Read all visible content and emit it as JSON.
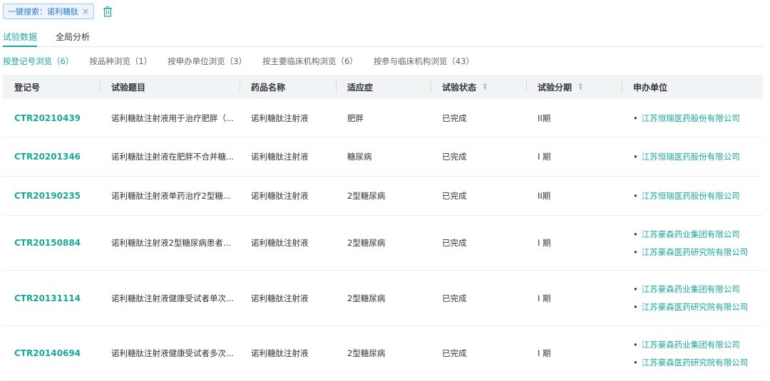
{
  "search": {
    "chip_label": "一键搜索：诺利糖肽",
    "close": "×"
  },
  "tabs": [
    {
      "label": "试验数据",
      "active": true
    },
    {
      "label": "全局分析",
      "active": false
    }
  ],
  "browse": [
    {
      "label": "按登记号浏览（6）",
      "active": true
    },
    {
      "label": "按品种浏览（1）",
      "active": false
    },
    {
      "label": "按申办单位浏览（3）",
      "active": false
    },
    {
      "label": "按主要临床机构浏览（6）",
      "active": false
    },
    {
      "label": "按参与临床机构浏览（43）",
      "active": false
    }
  ],
  "columns": [
    "登记号",
    "试验题目",
    "药品名称",
    "适应症",
    "试验状态",
    "试验分期",
    "申办单位"
  ],
  "rows": [
    {
      "reg": "CTR20210439",
      "title": "诺利糖肽注射液用于治疗肥胖（...",
      "drug": "诺利糖肽注射液",
      "indication": "肥胖",
      "status": "已完成",
      "phase": "II期",
      "sponsors": [
        "江苏恒瑞医药股份有限公司"
      ]
    },
    {
      "reg": "CTR20201346",
      "title": "诺利糖肽注射液在肥胖不合并糖...",
      "drug": "诺利糖肽注射液",
      "indication": "糖尿病",
      "status": "已完成",
      "phase": "I 期",
      "sponsors": [
        "江苏恒瑞医药股份有限公司"
      ]
    },
    {
      "reg": "CTR20190235",
      "title": "诺利糖肽注射液单药治疗2型糖...",
      "drug": "诺利糖肽注射液",
      "indication": "2型糖尿病",
      "status": "已完成",
      "phase": "II期",
      "sponsors": [
        "江苏恒瑞医药股份有限公司"
      ]
    },
    {
      "reg": "CTR20150884",
      "title": "诺利糖肽注射液2型糖尿病患者...",
      "drug": "诺利糖肽注射液",
      "indication": "2型糖尿病",
      "status": "已完成",
      "phase": "I 期",
      "sponsors": [
        "江苏豪森药业集团有限公司",
        "江苏豪森医药研究院有限公司"
      ]
    },
    {
      "reg": "CTR20131114",
      "title": "诺利糖肽注射液健康受试者单次...",
      "drug": "诺利糖肽注射液",
      "indication": "2型糖尿病",
      "status": "已完成",
      "phase": "I 期",
      "sponsors": [
        "江苏豪森药业集团有限公司",
        "江苏豪森医药研究院有限公司"
      ]
    },
    {
      "reg": "CTR20140694",
      "title": "诺利糖肽注射液健康受试者多次...",
      "drug": "诺利糖肽注射液",
      "indication": "2型糖尿病",
      "status": "已完成",
      "phase": "I 期",
      "sponsors": [
        "江苏豪森药业集团有限公司",
        "江苏豪森医药研究院有限公司"
      ]
    }
  ],
  "colors": {
    "accent": "#1aa89a",
    "chip": "#2a7ad6",
    "header_bg": "#f2f3f5"
  }
}
